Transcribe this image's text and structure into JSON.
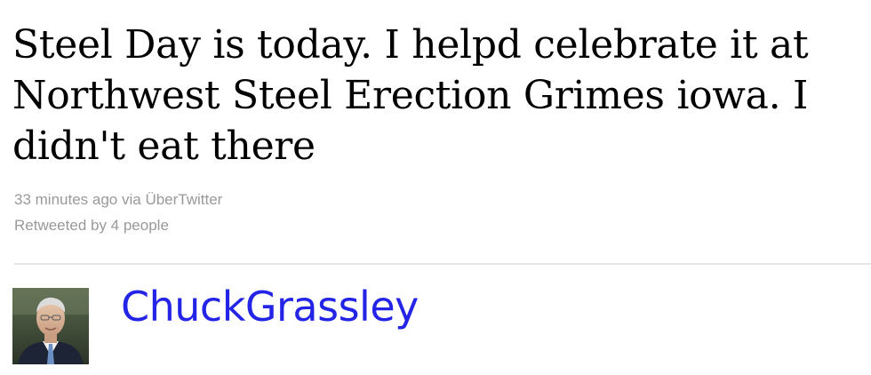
{
  "tweet": {
    "text": "Steel Day is today. I helpd celebrate it at Northwest Steel Erection Grimes iowa. I didn't eat there",
    "time_ago": "33 minutes ago",
    "via_prefix": " via ",
    "client": "ÜberTwitter",
    "retweet_info": "Retweeted by 4 people"
  },
  "author": {
    "screen_name": "ChuckGrassley",
    "avatar_icon": "profile-photo"
  },
  "colors": {
    "link": "#2424e6",
    "meta": "#999999",
    "divider": "#e6e6e6"
  }
}
